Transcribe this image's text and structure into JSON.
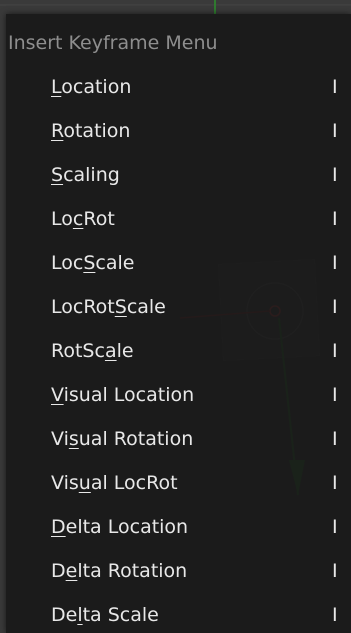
{
  "menu": {
    "title": "Insert Keyframe Menu",
    "items": [
      {
        "label": "Location",
        "underline_index": 0,
        "hotkey": "I"
      },
      {
        "label": "Rotation",
        "underline_index": 0,
        "hotkey": "I"
      },
      {
        "label": "Scaling",
        "underline_index": 0,
        "hotkey": "I"
      },
      {
        "label": "LocRot",
        "underline_index": 2,
        "hotkey": "I"
      },
      {
        "label": "LocScale",
        "underline_index": 3,
        "hotkey": "I"
      },
      {
        "label": "LocRotScale",
        "underline_index": 6,
        "hotkey": "I"
      },
      {
        "label": "RotScale",
        "underline_index": 5,
        "hotkey": "I"
      },
      {
        "label": "Visual Location",
        "underline_index": 0,
        "hotkey": "I"
      },
      {
        "label": "Visual Rotation",
        "underline_index": 2,
        "hotkey": "I"
      },
      {
        "label": "Visual LocRot",
        "underline_index": 3,
        "hotkey": "I"
      },
      {
        "label": "Delta Location",
        "underline_index": 0,
        "hotkey": "I"
      },
      {
        "label": "Delta Rotation",
        "underline_index": 1,
        "hotkey": "I"
      },
      {
        "label": "Delta Scale",
        "underline_index": 2,
        "hotkey": "I"
      }
    ]
  },
  "colors": {
    "menu_bg": "#181818",
    "title_text": "#8e8e8e",
    "item_text": "#e8e8e8",
    "viewport_bg": "#3a3a3a",
    "axis_y": "#2f7a2f",
    "axis_x": "#8a2a2a"
  }
}
